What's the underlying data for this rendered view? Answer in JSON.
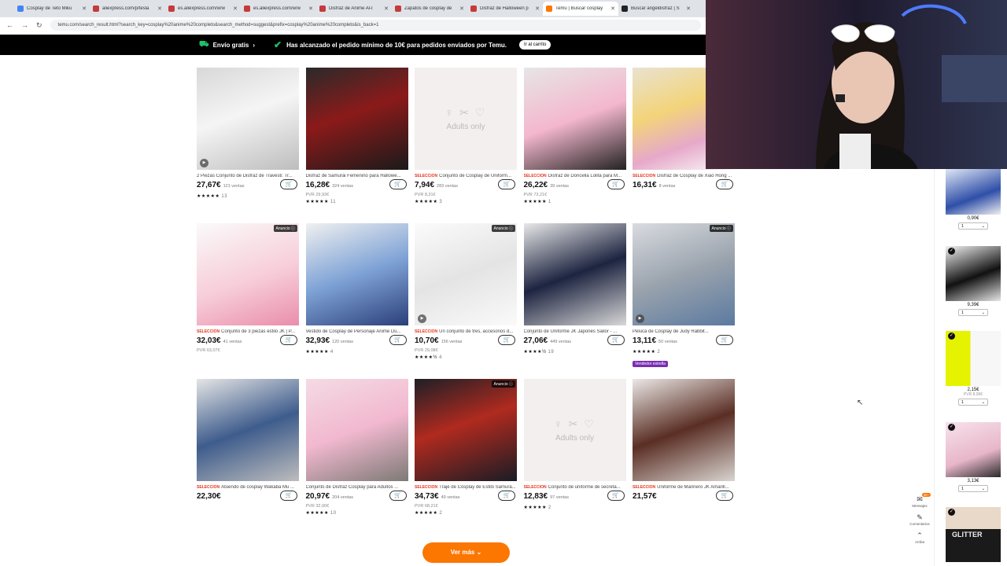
{
  "browser": {
    "tabs": [
      {
        "label": "Cosplay de Teto Miku",
        "favicon_color": "#4285f4",
        "active": false
      },
      {
        "label": "aliexpress.com/p/tesla",
        "favicon_color": "#c53a3a",
        "active": false
      },
      {
        "label": "es.aliexpress.com/w/w",
        "favicon_color": "#c53a3a",
        "active": false
      },
      {
        "label": "es.aliexpress.com/w/w",
        "favicon_color": "#c53a3a",
        "active": false
      },
      {
        "label": "Disfraz de Anime Al-I",
        "favicon_color": "#c53a3a",
        "active": false
      },
      {
        "label": "Zapatos de cosplay de",
        "favicon_color": "#c53a3a",
        "active": false
      },
      {
        "label": "Disfraz de Halloween p",
        "favicon_color": "#c53a3a",
        "active": false
      },
      {
        "label": "Temu | Buscar cosplay",
        "favicon_color": "#fb7701",
        "active": true
      },
      {
        "label": "Buscar angeldisfraz | S",
        "favicon_color": "#222222",
        "active": false
      }
    ],
    "url": "temu.com/search_result.html?search_key=cosplay%20anime%20completo&search_method=suggest&prefix=cosplay%20anime%20completo&is_back=1"
  },
  "promo_bar": {
    "shipping": "Envío gratis",
    "message": "Has alcanzado el pedido mínimo de 10€ para pedidos enviados por Temu.",
    "cart_button": "Ir al carrito"
  },
  "products": [
    {
      "title": "2 Piezas Conjunto de Disfraz de Travesti: Tr...",
      "seleccion": false,
      "price": "27,67€",
      "sold": "121 ventas",
      "pvr": "",
      "stars": "★★★★★",
      "reviews": "13",
      "ad": false,
      "video": true,
      "adults_only": false,
      "badge": "",
      "img_bg": "linear-gradient(160deg,#d8d8d8,#f5f5f5 45%,#bdbdbd)"
    },
    {
      "title": "Disfraz de Samurái Femenino para Hallowe...",
      "seleccion": false,
      "price": "16,28€",
      "sold": "324 ventas",
      "pvr": "PVR 29,93€",
      "stars": "★★★★★",
      "reviews": "11",
      "ad": false,
      "video": false,
      "adults_only": false,
      "badge": "",
      "img_bg": "linear-gradient(160deg,#2a2a2a,#8b1a1a 45%,#1a1a1a)"
    },
    {
      "title": "Conjunto de Cosplay de Uniform...",
      "seleccion": true,
      "price": "7,94€",
      "sold": "283 ventas",
      "pvr": "PVR 8,31€",
      "stars": "★★★★★",
      "reviews": "3",
      "ad": false,
      "video": false,
      "adults_only": true,
      "badge": "",
      "img_bg": "#f2efee"
    },
    {
      "title": "Disfraz de Doncella Lolita para M...",
      "seleccion": true,
      "price": "26,22€",
      "sold": "39 ventas",
      "pvr": "PVR 73,21€",
      "stars": "★★★★★",
      "reviews": "1",
      "ad": false,
      "video": false,
      "adults_only": false,
      "badge": "",
      "img_bg": "linear-gradient(160deg,#e6e6e6,#f4b7cd 50%,#222)"
    },
    {
      "title": "Disfraz de Cosplay de Xiao Hong ...",
      "seleccion": true,
      "price": "16,31€",
      "sold": "8 ventas",
      "pvr": "",
      "stars": "",
      "reviews": "",
      "ad": false,
      "video": false,
      "adults_only": false,
      "badge": "",
      "img_bg": "linear-gradient(160deg,#e9e2d0,#f3d47a 40%,#e6a9c9 70%,#fafafa)"
    },
    {
      "title": "Conjunto de 3 piezas estilo JK | P...",
      "seleccion": true,
      "price": "32,03€",
      "sold": "41 ventas",
      "pvr": "PVR 63,07€",
      "stars": "",
      "reviews": "",
      "ad": true,
      "video": false,
      "adults_only": false,
      "badge": "",
      "img_bg": "linear-gradient(160deg,#fafafa,#f7cdd9 55%,#e98eab)"
    },
    {
      "title": "Vestido de Cosplay de Personaje Anime Du...",
      "seleccion": false,
      "price": "32,93€",
      "sold": "120 ventas",
      "pvr": "",
      "stars": "★★★★★",
      "reviews": "4",
      "ad": false,
      "video": false,
      "adults_only": false,
      "badge": "",
      "img_bg": "linear-gradient(160deg,#f0f0f0,#7fa3d6 50%,#2b3f7a)"
    },
    {
      "title": "Un conjunto de tres, accesorios d...",
      "seleccion": true,
      "price": "10,70€",
      "sold": "156 ventas",
      "pvr": "PVR 29,08€",
      "stars": "★★★★½",
      "reviews": "4",
      "ad": true,
      "video": true,
      "adults_only": false,
      "badge": "",
      "img_bg": "linear-gradient(160deg,#fbfbfb,#e4e4e4 50%,#fafafa)"
    },
    {
      "title": "Conjunto de Uniforme JK Japonés Sailor - ...",
      "seleccion": false,
      "price": "27,06€",
      "sold": "449 ventas",
      "pvr": "",
      "stars": "★★★★½",
      "reviews": "19",
      "ad": false,
      "video": false,
      "adults_only": false,
      "badge": "",
      "img_bg": "linear-gradient(160deg,#e8e8e8,#1d2440 50%,#d8d8d8)"
    },
    {
      "title": "Peluca de Cosplay de Judy Rabbit...",
      "seleccion": false,
      "price": "13,11€",
      "sold": "50 ventas",
      "pvr": "",
      "stars": "★★★★★",
      "reviews": "2",
      "ad": true,
      "video": true,
      "adults_only": false,
      "badge": "Vendedor estrella",
      "img_bg": "linear-gradient(160deg,#d9dbe0,#9aa3ad 50%,#5b7aa0)"
    },
    {
      "title": "Atuendo de cosplay Wakaba Mu ...",
      "seleccion": true,
      "price": "22,30€",
      "sold": "",
      "pvr": "",
      "stars": "",
      "reviews": "",
      "ad": false,
      "video": false,
      "adults_only": false,
      "badge": "",
      "img_bg": "linear-gradient(160deg,#e5e5e5,#3e5c8c 50%,#bdbdbd)"
    },
    {
      "title": "Conjunto de Disfraz Cosplay para Adultos ...",
      "seleccion": false,
      "price": "20,97€",
      "sold": "204 ventas",
      "pvr": "PVR 32,00€",
      "stars": "★★★★★",
      "reviews": "10",
      "ad": false,
      "video": false,
      "adults_only": false,
      "badge": "",
      "img_bg": "linear-gradient(160deg,#f4dbe4,#f2b8cf 50%,#7d7a76)"
    },
    {
      "title": "Traje de Cosplay de Estilo Samurá...",
      "seleccion": true,
      "price": "34,73€",
      "sold": "49 ventas",
      "pvr": "PVR 68,21€",
      "stars": "★★★★★",
      "reviews": "2",
      "ad": true,
      "video": false,
      "adults_only": false,
      "badge": "",
      "img_bg": "linear-gradient(160deg,#1d1f26,#b02a1f 45%,#1a1c24)"
    },
    {
      "title": "Conjunto de uniforme de secreta...",
      "seleccion": true,
      "price": "12,83€",
      "sold": "97 ventas",
      "pvr": "",
      "stars": "★★★★★",
      "reviews": "2",
      "ad": false,
      "video": false,
      "adults_only": true,
      "badge": "",
      "img_bg": "#f2efee"
    },
    {
      "title": "Uniforme de Marinero JK Amarill...",
      "seleccion": true,
      "price": "21,57€",
      "sold": "",
      "pvr": "",
      "stars": "",
      "reviews": "",
      "ad": false,
      "video": false,
      "adults_only": false,
      "badge": "",
      "img_bg": "linear-gradient(160deg,#ebe8e6,#5a2e24 50%,#d9d4d0)"
    }
  ],
  "labels": {
    "seleccion": "SELECCIÓN",
    "ad": "Anuncio ⓘ",
    "adults_only": "Adults only",
    "add_to_cart": "🛒"
  },
  "see_more": "Ver más ⌄",
  "side_cart": {
    "items": [
      {
        "price": "0,90€",
        "pvr": "",
        "qty": "1",
        "img_bg": "linear-gradient(160deg,#dfe6f4,#2f4fa8 60%,#f0f0f0)"
      },
      {
        "price": "9,39€",
        "pvr": "",
        "qty": "1",
        "img_bg": "linear-gradient(160deg,#f2f2f2,#111 55%,#e6e6e6)"
      },
      {
        "price": "2,15€",
        "pvr": "PVR 8,99€",
        "qty": "1",
        "img_bg": "linear-gradient(90deg,#e5f200 45%,#f7f7f7 45%)"
      },
      {
        "price": "3,13€",
        "pvr": "",
        "qty": "1",
        "img_bg": "linear-gradient(160deg,#f8e2ec,#e7b6c9 60%,#2b2b2b)"
      },
      {
        "price": "",
        "pvr": "",
        "qty": "",
        "img_bg": "linear-gradient(180deg,#e9d9c9 40%,#1a1a1a 40%)"
      }
    ],
    "glitter_text": "GLITTER"
  },
  "side_icons": [
    {
      "label": "Mensajes",
      "glyph": "✉",
      "badge": "99+"
    },
    {
      "label": "Comentarios",
      "glyph": "✎",
      "badge": ""
    },
    {
      "label": "Arriba",
      "glyph": "⌃",
      "badge": ""
    }
  ],
  "colors": {
    "brand_orange": "#fb7701",
    "seleccion_red": "#e6341c",
    "promo_green": "#21c16b",
    "star_badge": "#7a2db0"
  }
}
